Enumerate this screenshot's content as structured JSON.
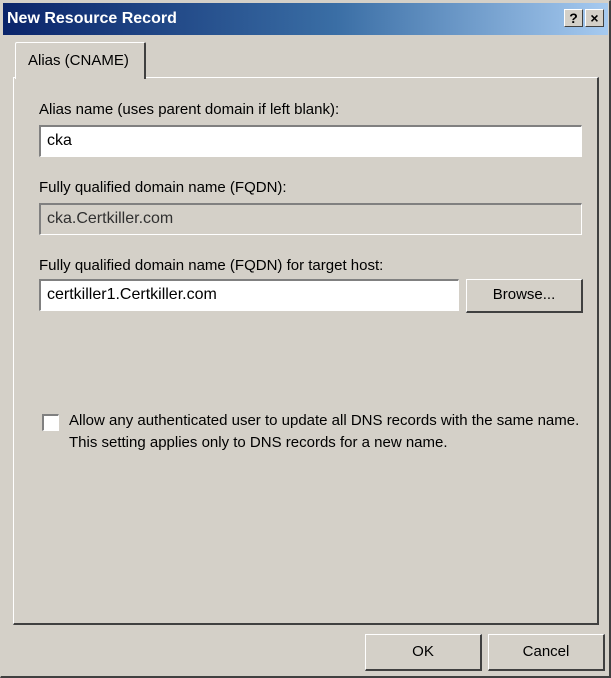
{
  "window": {
    "title": "New Resource Record",
    "help_glyph": "?",
    "close_glyph": "×"
  },
  "tabs": [
    {
      "label": "Alias (CNAME)"
    }
  ],
  "form": {
    "alias_label": "Alias name (uses parent domain if left blank):",
    "alias_value": "cka",
    "fqdn_label": "Fully qualified domain name (FQDN):",
    "fqdn_value": "cka.Certkiller.com",
    "target_label": "Fully qualified domain name (FQDN) for target host:",
    "target_value": "certkiller1.Certkiller.com",
    "browse_label": "Browse...",
    "checkbox_label": "Allow any authenticated user to update all DNS records with the same name. This setting applies only to DNS records for a new name.",
    "checkbox_checked": false
  },
  "buttons": {
    "ok_label": "OK",
    "cancel_label": "Cancel"
  },
  "colors": {
    "title_gradient_start": "#0a246a",
    "title_gradient_end": "#a6caf0",
    "dialog_face": "#d4d0c8"
  }
}
